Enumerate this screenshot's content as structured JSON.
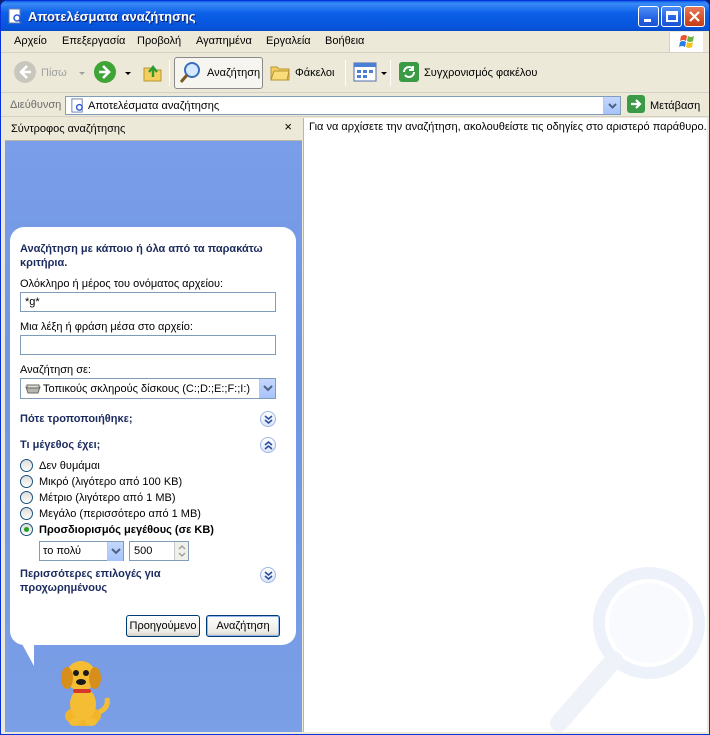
{
  "window": {
    "title": "Αποτελέσματα αναζήτησης"
  },
  "menu": [
    "Αρχείο",
    "Επεξεργασία",
    "Προβολή",
    "Αγαπημένα",
    "Εργαλεία",
    "Βοήθεια"
  ],
  "toolbar": {
    "back_label": "Πίσω",
    "search_label": "Αναζήτηση",
    "folders_label": "Φάκελοι",
    "sync_label": "Συγχρονισμός φακέλου"
  },
  "address": {
    "label": "Διεύθυνση",
    "value": "Αποτελέσματα αναζήτησης",
    "go_label": "Μετάβαση"
  },
  "search_pane": {
    "header": "Σύντροφος αναζήτησης",
    "close_glyph": "×",
    "intro": "Αναζήτηση με κάποιο ή όλα από τα παρακάτω κριτήρια.",
    "filename_label": "Ολόκληρο ή μέρος του ονόματος αρχείου:",
    "filename_value": "*g*",
    "phrase_label": "Μια λέξη ή φράση μέσα στο αρχείο:",
    "phrase_value": "",
    "lookin_label": "Αναζήτηση σε:",
    "lookin_value": "Τοπικούς σκληρούς δίσκους (C:;D:;E:;F:;I:)",
    "modified_section": "Πότε τροποποιήθηκε;",
    "size_section": "Τι μέγεθος έχει;",
    "size_options": [
      {
        "label": "Δεν θυμάμαι",
        "checked": false
      },
      {
        "label": "Μικρό (λιγότερο από 100 KB)",
        "checked": false
      },
      {
        "label": "Μέτριο (λιγότερο από 1 MB)",
        "checked": false
      },
      {
        "label": "Μεγάλο (περισσότερο από 1 MB)",
        "checked": false
      },
      {
        "label": "Προσδιορισμός μεγέθους (σε KB)",
        "checked": true
      }
    ],
    "size_qualifier": "το πολύ",
    "size_value": "500",
    "advanced_section": "Περισσότερες επιλογές για προχωρημένους",
    "back_button": "Προηγούμενο",
    "search_button": "Αναζήτηση"
  },
  "results_pane": {
    "instructions": "Για να αρχίσετε την αναζήτηση, ακολουθείστε τις οδηγίες στο αριστερό παράθυρο."
  },
  "colors": {
    "titlebar": "#0c60e8",
    "pane_blue": "#7a9ee9",
    "section_text": "#1b2b5e"
  }
}
